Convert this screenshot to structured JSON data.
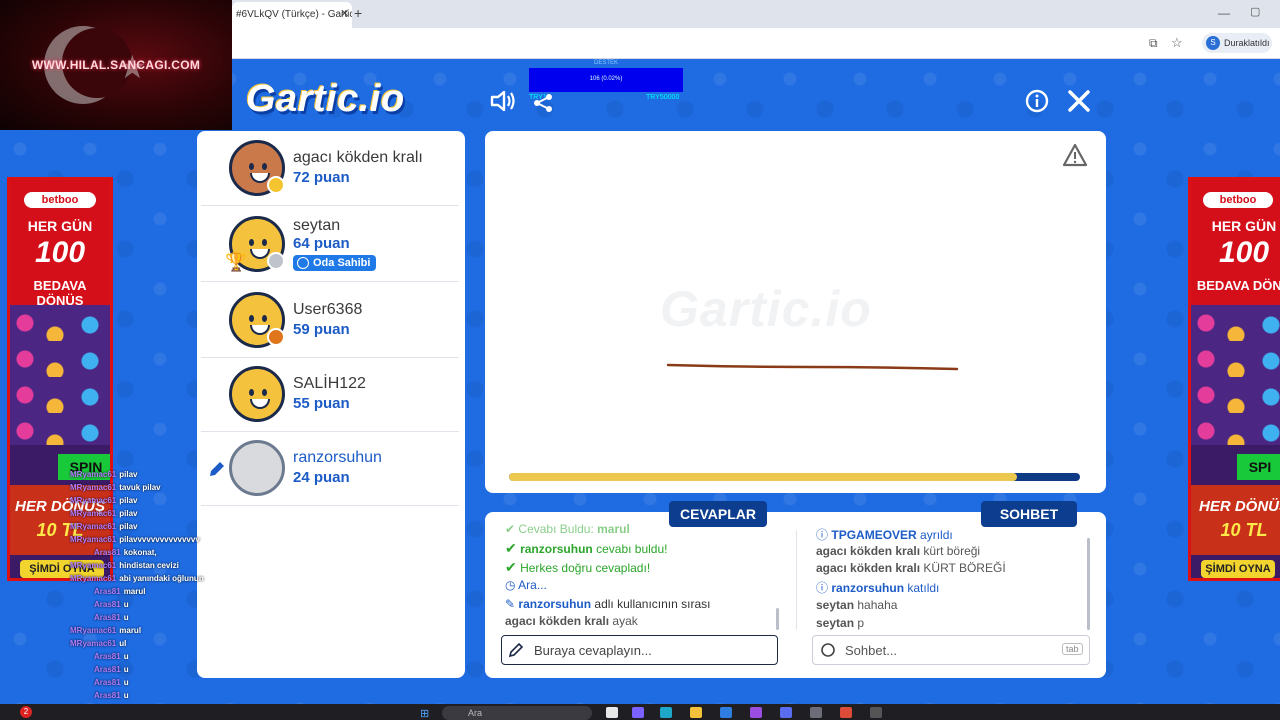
{
  "browser": {
    "tab_title": "#6VLkQV (Türkçe) - Gartic",
    "tab_close": "✕",
    "new_tab": "+",
    "profile_initial": "S",
    "paused_label": "Duraklatıldı"
  },
  "overlay": {
    "url": "WWW.HILAL.SANCAGI.COM"
  },
  "stream_widget": {
    "label": "DESTEK",
    "progress": "106 (0.02%)",
    "left": "TRY10",
    "right": "TRY50000"
  },
  "game": {
    "logo": "Gartic.io",
    "watermark": "Gartic.io",
    "timer_progress": 0.89,
    "players": [
      {
        "name": "agacı kökden kralı",
        "points": "72 puan",
        "status_color": "#f5c431"
      },
      {
        "name": "seytan",
        "points": "64 puan",
        "status_color": "#bfc4cc",
        "badge": "Oda Sahibi"
      },
      {
        "name": "User6368",
        "points": "59 puan",
        "status_color": "#e0761c"
      },
      {
        "name": "SALİH122",
        "points": "55 puan",
        "status_color": "#f4c23d"
      },
      {
        "name": "ranzorsuhun",
        "points": "24 puan",
        "status_color": "#9aa3b0"
      }
    ],
    "answers_tab": "CEVAPLAR",
    "chat_tab": "SOHBET",
    "answers": [
      {
        "user": "Cevabı Buldu:",
        "text": "marul",
        "kind": "cut"
      },
      {
        "user": "ranzorsuhun",
        "text": "cevabı buldu!",
        "kind": "green"
      },
      {
        "user": "",
        "text": "Herkes doğru cevapladı!",
        "kind": "green"
      },
      {
        "user": "",
        "text": "Ara...",
        "kind": "blue"
      },
      {
        "user": "ranzorsuhun",
        "text": "adlı kullanıcının sırası",
        "kind": "turn"
      },
      {
        "user": "agacı kökden kralı",
        "text": "ayak",
        "kind": "plain"
      }
    ],
    "chat": [
      {
        "user": "TPGAMEOVER",
        "text": "ayrıldı",
        "kind": "info"
      },
      {
        "user": "agacı kökden kralı",
        "text": "kürt böreği",
        "kind": "plain"
      },
      {
        "user": "agacı kökden kralı",
        "text": "KÜRT BÖREĞİ",
        "kind": "plain"
      },
      {
        "user": "ranzorsuhun",
        "text": "katıldı",
        "kind": "info"
      },
      {
        "user": "seytan",
        "text": "hahaha",
        "kind": "plain"
      },
      {
        "user": "seytan",
        "text": "p",
        "kind": "plain"
      }
    ],
    "answer_placeholder": "Buraya cevaplayın...",
    "chat_placeholder": "Sohbet...",
    "tab_key": "tab"
  },
  "ads": {
    "brand": "betboo",
    "line1": "HER GÜN",
    "line2": "100",
    "line3": "BEDAVA DÖNÜŞ",
    "spin": "SPIN",
    "bottom1": "HER DÖNÜŞ",
    "bottom2": "10 TL",
    "cta": "ŞİMDİ OYNA",
    "right_line3": "BEDAVA DÖNÜ",
    "right_spin": "SPI",
    "right_bottom1": "HER DÖNÜŞ",
    "right_bottom2": "10 TL"
  },
  "stream_chat": [
    {
      "user": "MRyamac61",
      "text": "pilav"
    },
    {
      "user": "MRyamac61",
      "text": "tavuk pilav"
    },
    {
      "user": "MRyamac61",
      "text": "pilav"
    },
    {
      "user": "MRyamac61",
      "text": "pilav"
    },
    {
      "user": "MRyamac61",
      "text": "pilav"
    },
    {
      "user": "MRyamac61",
      "text": "pilavvvvvvvvvvvvvvv"
    },
    {
      "user": "Aras81",
      "text": "kokonat,"
    },
    {
      "user": "MRyamac61",
      "text": "hindistan cevizi"
    },
    {
      "user": "MRyamac61",
      "text": "abi yanındaki oğlunun"
    },
    {
      "user": "Aras81",
      "text": "marul"
    },
    {
      "user": "Aras81",
      "text": "u"
    },
    {
      "user": "Aras81",
      "text": "u"
    },
    {
      "user": "MRyamac61",
      "text": "marul"
    },
    {
      "user": "MRyamac61",
      "text": "ul"
    },
    {
      "user": "Aras81",
      "text": "u"
    },
    {
      "user": "Aras81",
      "text": "u"
    },
    {
      "user": "Aras81",
      "text": "u"
    },
    {
      "user": "Aras81",
      "text": "u"
    },
    {
      "user": "Aras81",
      "text": "u"
    }
  ],
  "taskbar": {
    "search": "Ara",
    "notifications": "2"
  }
}
